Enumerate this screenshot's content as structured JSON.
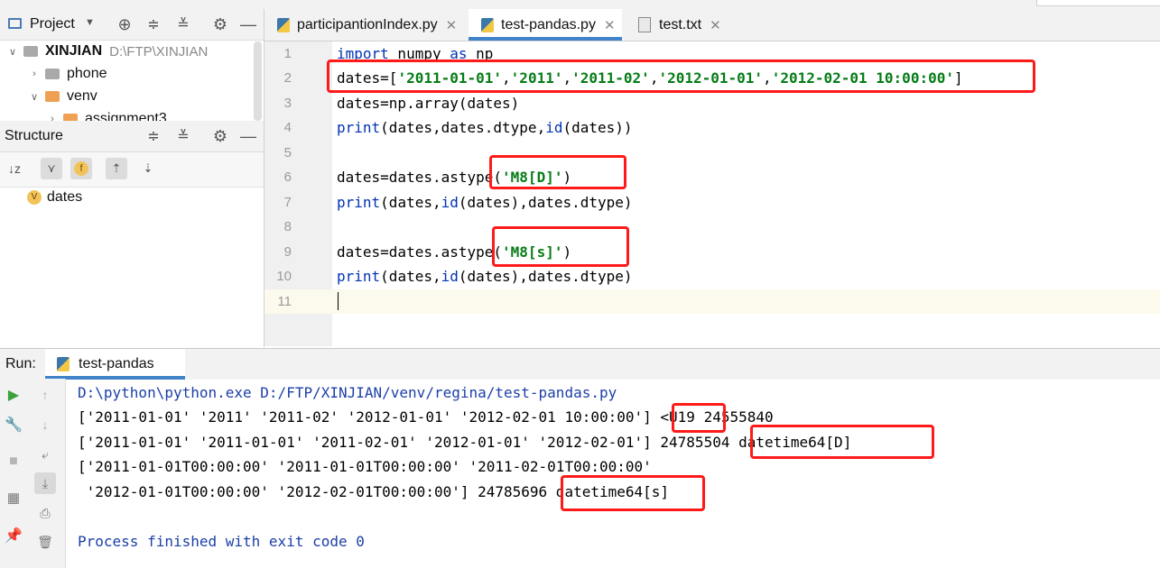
{
  "project_panel": {
    "title": "Project",
    "root": {
      "name": "XINJIAN",
      "path": "D:\\FTP\\XINJIAN"
    },
    "items": [
      "phone",
      "venv",
      "assignment3"
    ]
  },
  "structure_panel": {
    "title": "Structure",
    "items": [
      {
        "badge": "V",
        "label": "dates"
      }
    ]
  },
  "tabs": [
    {
      "label": "participantionIndex.py",
      "active": false
    },
    {
      "label": "test-pandas.py",
      "active": true
    },
    {
      "label": "test.txt",
      "active": false
    }
  ],
  "line_numbers": [
    "1",
    "2",
    "3",
    "4",
    "5",
    "6",
    "7",
    "8",
    "9",
    "10",
    "11"
  ],
  "code": {
    "l1": {
      "kw1": "import",
      "t1": " numpy ",
      "kw2": "as",
      "t2": " np"
    },
    "l2": {
      "t1": "dates=[",
      "s1": "'2011-01-01'",
      "c1": ",",
      "s2": "'2011'",
      "c2": ",",
      "s3": "'2011-02'",
      "c3": ",",
      "s4": "'2012-01-01'",
      "c4": ",",
      "s5": "'2012-02-01 10:00:00'",
      "t2": "]"
    },
    "l3": "dates=np.array(dates)",
    "l4": {
      "f1": "print",
      "t1": "(dates,dates.dtype,",
      "f2": "id",
      "t2": "(dates))"
    },
    "l6": {
      "t1": "dates=dates.astype(",
      "s1": "'M8[D]'",
      "t2": ")"
    },
    "l7": {
      "f1": "print",
      "t1": "(dates,",
      "f2": "id",
      "t2": "(dates),dates.dtype)"
    },
    "l9": {
      "t1": "dates=dates.astype(",
      "s1": "'M8[s]'",
      "t2": ")"
    },
    "l10": {
      "f1": "print",
      "t1": "(dates,",
      "f2": "id",
      "t2": "(dates),dates.dtype)"
    }
  },
  "run": {
    "label": "Run:",
    "tab": "test-pandas",
    "output": [
      "D:\\python\\python.exe D:/FTP/XINJIAN/venv/regina/test-pandas.py",
      "['2011-01-01' '2011' '2011-02' '2012-01-01' '2012-02-01 10:00:00'] <U19 24555840",
      "['2011-01-01' '2011-01-01' '2011-02-01' '2012-01-01' '2012-02-01'] 24785504 datetime64[D]",
      "['2011-01-01T00:00:00' '2011-01-01T00:00:00' '2011-02-01T00:00:00'",
      " '2012-01-01T00:00:00' '2012-02-01T00:00:00'] 24785696 datetime64[s]",
      "",
      "Process finished with exit code 0"
    ]
  },
  "colors": {
    "keyword": "#0033b3",
    "string": "#067d17",
    "highlight": "#ff1a1a",
    "output_path": "#1c3fa8"
  }
}
